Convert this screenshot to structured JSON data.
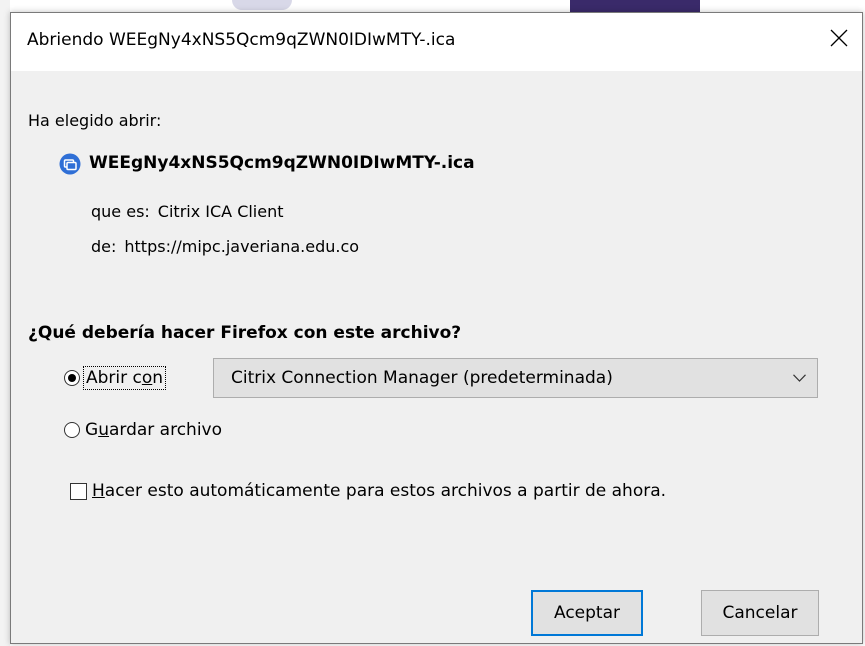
{
  "window": {
    "title": "Abriendo WEEgNy4xNS5Qcm9qZWN0IDIwMTY-.ica"
  },
  "dialog": {
    "chosen_label": "Ha elegido abrir:",
    "file_name": "WEEgNy4xNS5Qcm9qZWN0IDIwMTY-.ica",
    "file_icon": "citrix-file-icon",
    "type_key": "que es:",
    "type_value": "Citrix ICA Client",
    "from_key": "de:",
    "from_value": "https://mipc.javeriana.edu.co",
    "question": "¿Qué debería hacer Firefox con este archivo?",
    "open_with": {
      "label_pre": "Abrir c",
      "label_accel": "o",
      "label_post": "n",
      "selected": true,
      "app": "Citrix Connection Manager (predeterminada)"
    },
    "save_file": {
      "label_pre": "G",
      "label_accel": "u",
      "label_post": "ardar archivo",
      "selected": false
    },
    "auto_checkbox": {
      "label_accel": "H",
      "label_post": "acer esto automáticamente para estos archivos a partir de ahora.",
      "checked": false
    },
    "buttons": {
      "accept": "Aceptar",
      "cancel": "Cancelar"
    }
  },
  "colors": {
    "focus_border": "#0078d7",
    "dialog_bg": "#f0f0f0",
    "button_bg": "#e1e1e1",
    "icon_blue": "#2f6fd6"
  }
}
